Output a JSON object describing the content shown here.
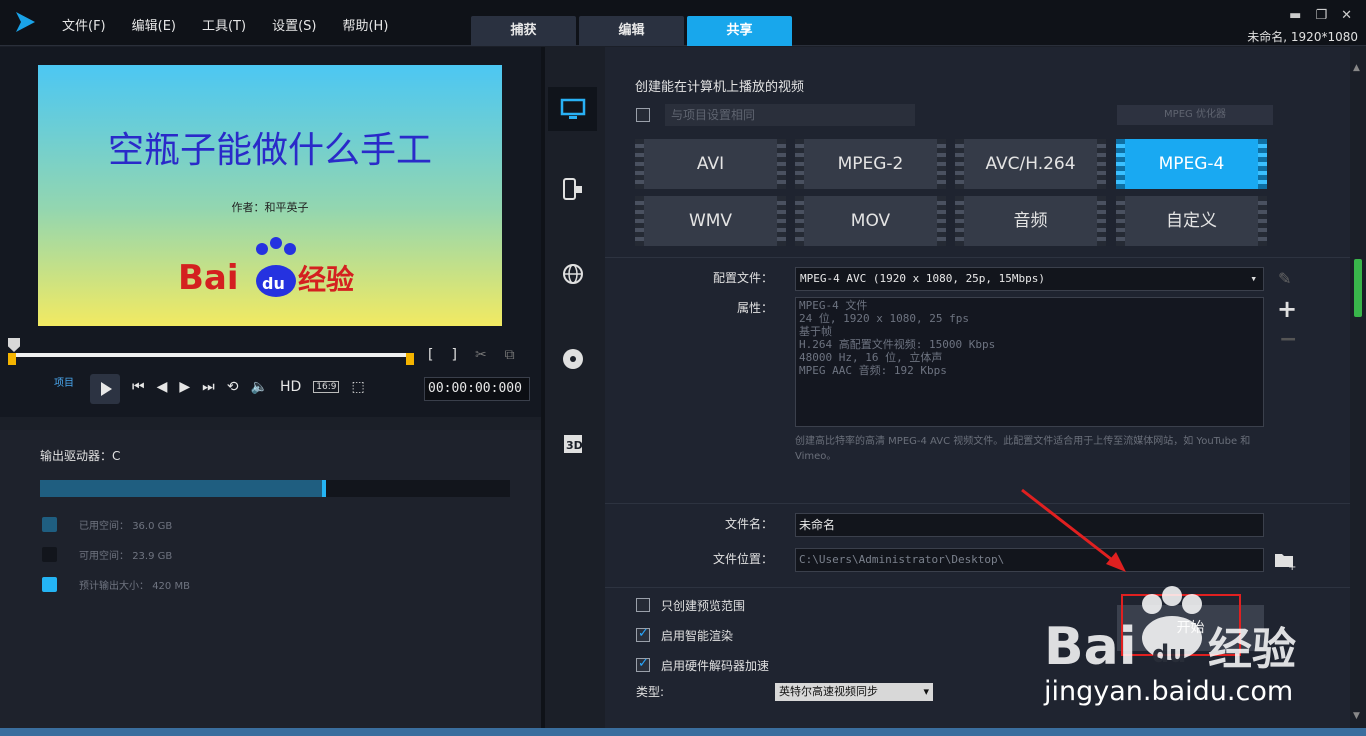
{
  "menu": [
    "文件(F)",
    "编辑(E)",
    "工具(T)",
    "设置(S)",
    "帮助(H)"
  ],
  "tabs": [
    {
      "label": "捕获"
    },
    {
      "label": "编辑"
    },
    {
      "label": "共享",
      "active": true
    }
  ],
  "project_info": "未命名, 1920*1080",
  "preview": {
    "title": "空瓶子能做什么手工",
    "author": "作者：和平英子",
    "logo_text": "Bai du 经验"
  },
  "player": {
    "project_label": "项目",
    "hd_label": "HD",
    "aspect": "16:9",
    "timecode": "00:00:00:000"
  },
  "drive": {
    "title": "输出驱动器：C",
    "used_fraction": 0.6,
    "legend": [
      {
        "label": "已用空间：",
        "value": "36.0 GB",
        "color": "#1f5e80"
      },
      {
        "label": "可用空间：",
        "value": "23.9 GB",
        "color": "#12151c"
      },
      {
        "label": "预计输出大小：",
        "value": "420 MB",
        "color": "#24b4f4"
      }
    ]
  },
  "share": {
    "section_title": "创建能在计算机上播放的视频",
    "same_as_project": "与项目设置相同",
    "mpeg_optimizer": "MPEG 优化器",
    "formats": [
      "AVI",
      "MPEG-2",
      "AVC/H.264",
      "MPEG-4",
      "WMV",
      "MOV",
      "音频",
      "自定义"
    ],
    "active_format": "MPEG-4",
    "profile_label": "配置文件：",
    "profile_value": "MPEG-4 AVC (1920 x 1080, 25p, 15Mbps)",
    "props_label": "属性：",
    "properties": [
      "MPEG-4 文件",
      "24 位, 1920 x 1080, 25 fps",
      "基于帧",
      "H.264 高配置文件视频: 15000 Kbps",
      "48000 Hz, 16 位, 立体声",
      "MPEG AAC 音频: 192 Kbps"
    ],
    "description": "创建高比特率的高清 MPEG-4 AVC 视频文件。此配置文件适合用于上传至流媒体网站，如 YouTube 和 Vimeo。",
    "filename_label": "文件名：",
    "filename_value": "未命名",
    "location_label": "文件位置：",
    "location_value": "C:\\Users\\Administrator\\Desktop\\",
    "options": [
      {
        "label": "只创建预览范围",
        "checked": false
      },
      {
        "label": "启用智能渲染",
        "checked": true
      },
      {
        "label": "启用硬件解码器加速",
        "checked": true
      }
    ],
    "type_label": "类型:",
    "type_value": "英特尔高速视频同步",
    "start_label": "开始"
  },
  "watermark": {
    "url": "jingyan.baidu.com"
  },
  "colors": {
    "accent": "#18a7ec",
    "annotation": "#e02020"
  }
}
